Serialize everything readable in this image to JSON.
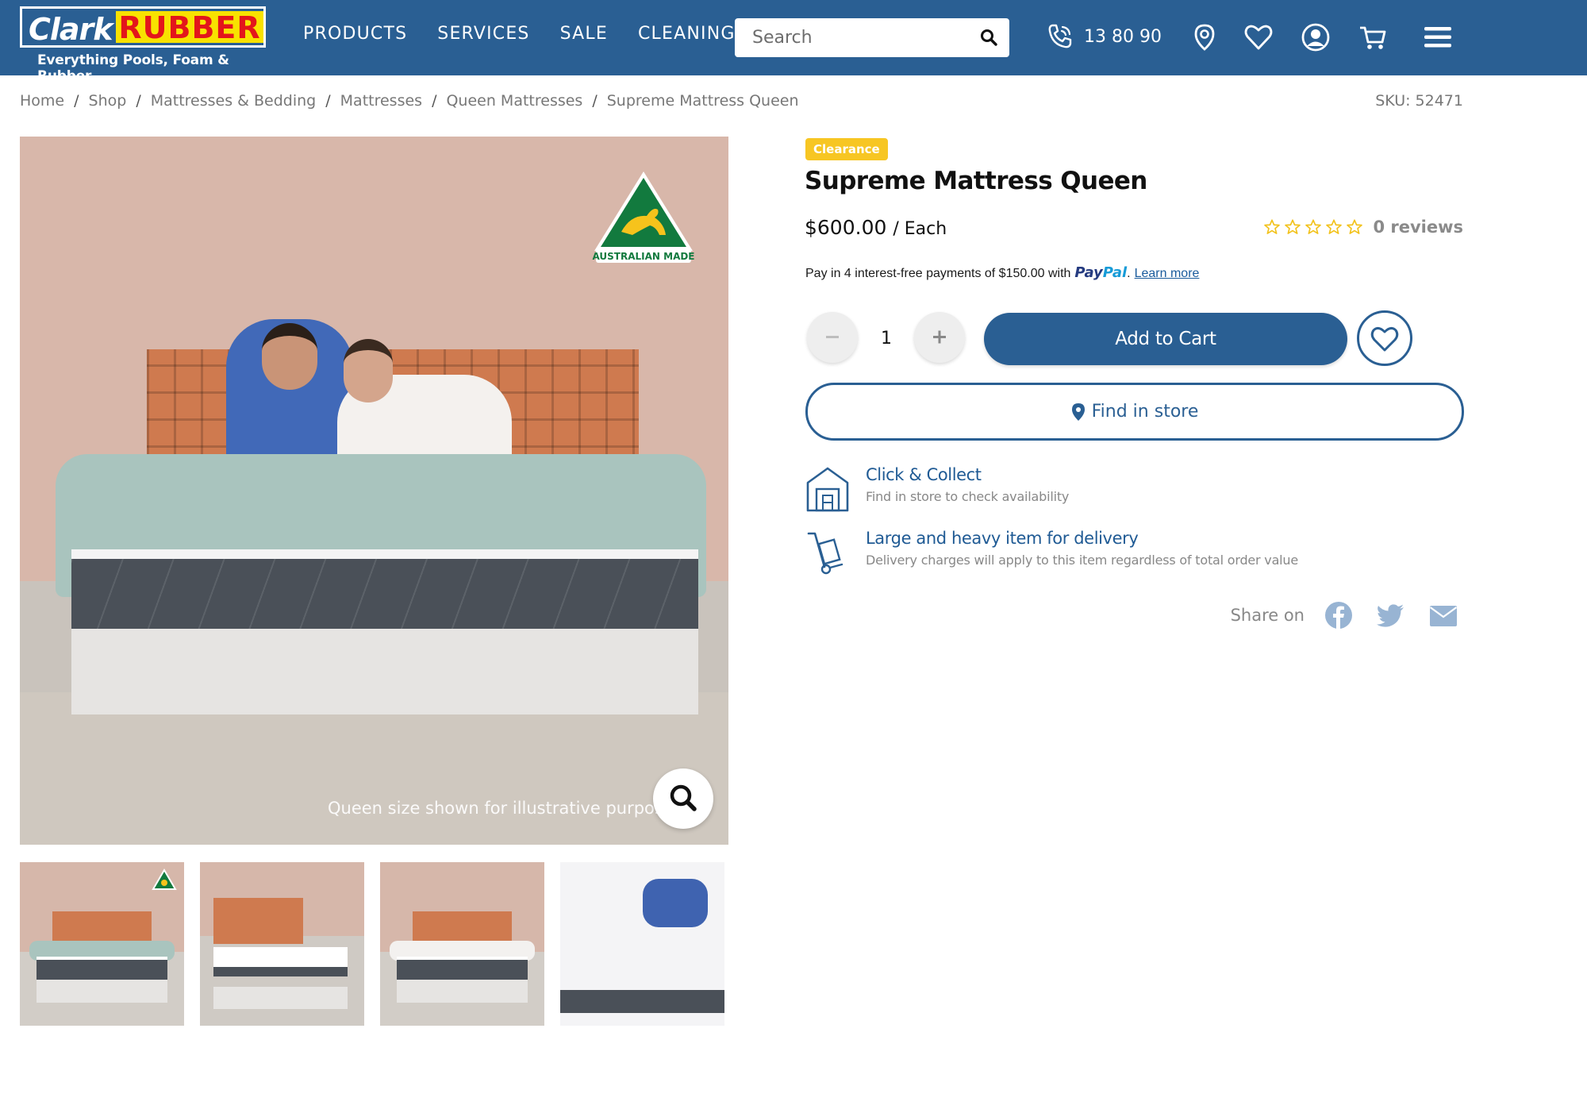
{
  "header": {
    "logo": {
      "word1": "Clark",
      "word2": "RUBBER",
      "tagline": "Everything Pools, Foam & Rubber"
    },
    "nav": [
      "PRODUCTS",
      "SERVICES",
      "SALE",
      "CLEANING"
    ],
    "search": {
      "placeholder": "Search",
      "icon": "search-icon"
    },
    "phone": {
      "number": "13 80 90",
      "icon": "phone-icon"
    },
    "icons": [
      "location-pin-icon",
      "heart-icon",
      "account-icon",
      "cart-icon",
      "menu-icon"
    ],
    "colors": {
      "bar": "#2a5f93",
      "logo_yellow": "#f8e200",
      "logo_red": "#e3161b"
    }
  },
  "breadcrumb": [
    "Home",
    "Shop",
    "Mattresses & Bedding",
    "Mattresses",
    "Queen Mattresses",
    "Supreme Mattress Queen"
  ],
  "sku": "SKU: 52471",
  "gallery": {
    "badge_text": "AUSTRALIAN MADE",
    "caption": "Queen size shown for illustrative purposes",
    "zoom_icon": "magnifier-icon",
    "thumbnails": 4
  },
  "product": {
    "badge": "Clearance",
    "title": "Supreme Mattress Queen",
    "price": "$600.00",
    "price_unit": "/ Each",
    "rating": {
      "stars": 0,
      "max": 5,
      "reviews": "0 reviews"
    },
    "paypal": {
      "text": "Pay in 4 interest-free payments of $150.00 with",
      "brand_a": "Pay",
      "brand_b": "Pal",
      "suffix": ".",
      "learn_more": "Learn more"
    },
    "quantity": "1",
    "add_to_cart": "Add to Cart",
    "find_in_store": "Find in store",
    "click_collect": {
      "title": "Click & Collect",
      "subtitle": "Find in store to check availability"
    },
    "delivery": {
      "title": "Large and heavy item for delivery",
      "subtitle": "Delivery charges will apply to this item regardless of total order value"
    },
    "share": {
      "label": "Share on",
      "icons": [
        "facebook-icon",
        "twitter-icon",
        "email-icon"
      ]
    },
    "colors": {
      "primary": "#2a5f93",
      "badge": "#f7c623",
      "star": "#f2c21b"
    }
  }
}
